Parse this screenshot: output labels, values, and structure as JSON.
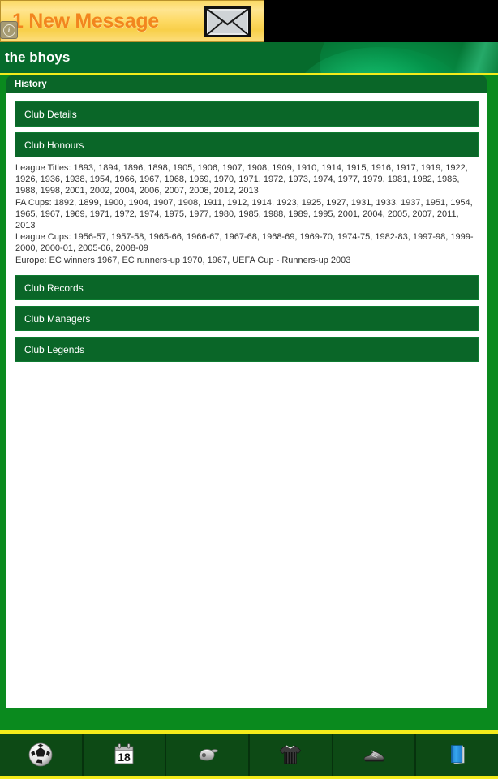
{
  "ad": {
    "text": "1 New Message",
    "envelope_icon": "envelope-icon",
    "info_badge": "i",
    "bg_color": "#fdd961",
    "text_color": "#f2861e"
  },
  "header": {
    "title": "the bhoys",
    "bg_color": "#066b2c"
  },
  "tab": {
    "label": "History",
    "bg_color": "#0a6628"
  },
  "frame": {
    "accent_color": "#f3ec1b",
    "frame_color": "#0a8a1e"
  },
  "sections": [
    {
      "label": "Club Details",
      "expanded": false
    },
    {
      "label": "Club Honours",
      "expanded": true
    },
    {
      "label": "Club Records",
      "expanded": false
    },
    {
      "label": "Club Managers",
      "expanded": false
    },
    {
      "label": "Club Legends",
      "expanded": false
    }
  ],
  "honours": {
    "league_titles": "League Titles: 1893, 1894, 1896, 1898, 1905, 1906, 1907, 1908, 1909, 1910, 1914, 1915, 1916, 1917, 1919, 1922, 1926, 1936, 1938, 1954, 1966, 1967, 1968, 1969, 1970, 1971, 1972, 1973, 1974, 1977, 1979, 1981, 1982, 1986, 1988, 1998, 2001, 2002, 2004, 2006, 2007, 2008, 2012, 2013",
    "fa_cups": "FA Cups: 1892, 1899, 1900, 1904, 1907, 1908, 1911, 1912, 1914, 1923, 1925, 1927, 1931, 1933, 1937, 1951, 1954, 1965, 1967, 1969, 1971, 1972, 1974, 1975, 1977, 1980, 1985, 1988, 1989, 1995, 2001, 2004, 2005, 2007, 2011, 2013",
    "league_cups": "League Cups: 1956-57, 1957-58, 1965-66, 1966-67, 1967-68, 1968-69, 1969-70, 1974-75, 1982-83, 1997-98, 1999-2000, 2000-01, 2005-06, 2008-09",
    "europe": "Europe: EC winners 1967, EC runners-up 1970, 1967, UEFA Cup - Runners-up 2003"
  },
  "nav": {
    "items": [
      {
        "icon": "football-icon",
        "name": "nav-football"
      },
      {
        "icon": "calendar-icon",
        "name": "nav-fixtures",
        "day": "18"
      },
      {
        "icon": "whistle-icon",
        "name": "nav-whistle"
      },
      {
        "icon": "jersey-icon",
        "name": "nav-squad"
      },
      {
        "icon": "boot-icon",
        "name": "nav-boot"
      },
      {
        "icon": "book-icon",
        "name": "nav-history"
      }
    ]
  }
}
